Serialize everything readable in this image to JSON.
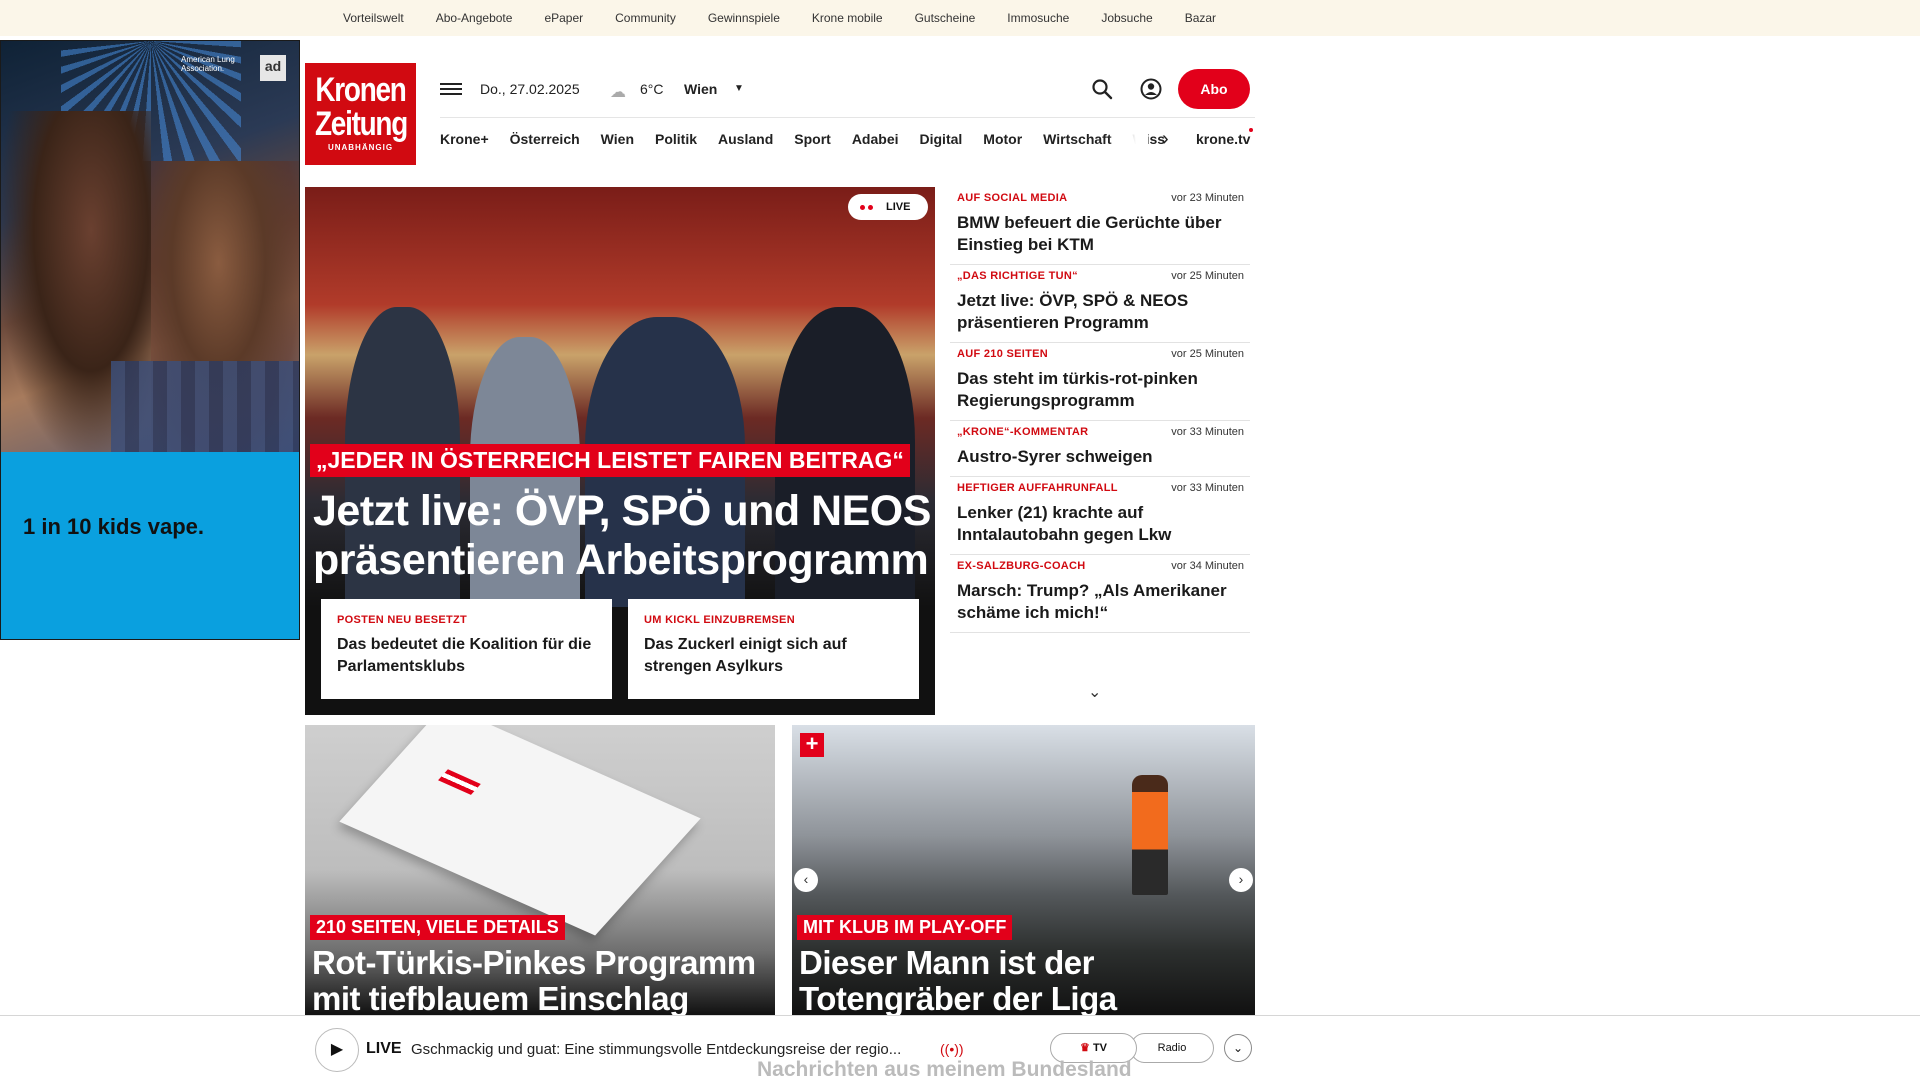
{
  "topbar": {
    "links": [
      "Vorteilswelt",
      "Abo-Angebote",
      "ePaper",
      "Community",
      "Gewinnspiele",
      "Krone mobile",
      "Gutscheine",
      "Immosuche",
      "Jobsuche",
      "Bazar"
    ]
  },
  "ad": {
    "sponsor": "American Lung Association.",
    "badge": "ad",
    "tagline": "1 in 10 kids vape."
  },
  "logo": {
    "line1": "Kronen",
    "line2": "Zeitung",
    "sub": "UNABHÄNGIG"
  },
  "header": {
    "date": "Do., 27.02.2025",
    "weather_icon": "cloud-icon",
    "temperature": "6°C",
    "city": "Wien",
    "abo": "Abo"
  },
  "nav": {
    "items": [
      "Krone+",
      "Österreich",
      "Wien",
      "Politik",
      "Ausland",
      "Sport",
      "Adabei",
      "Digital",
      "Motor",
      "Wirtschaft",
      "Wiss"
    ],
    "tv": "krone.tv"
  },
  "hero": {
    "live": "LIVE",
    "kicker": "„JEDER IN ÖSTERREICH LEISTET FAIREN BEITRAG“",
    "title": "Jetzt live: ÖVP, SPÖ und NEOS präsentieren Arbeitsprogramm",
    "cards": [
      {
        "kicker": "POSTEN NEU BESETZT",
        "headline": "Das bedeutet die Koalition für die Parlamentsklubs"
      },
      {
        "kicker": "UM KICKL EINZUBREMSEN",
        "headline": "Das Zuckerl einigt sich auf strengen Asylkurs"
      }
    ]
  },
  "news": [
    {
      "kicker": "AUF SOCIAL MEDIA",
      "time": "vor 23 Minuten",
      "headline": "BMW befeuert die Gerüchte über Einstieg bei KTM"
    },
    {
      "kicker": "„DAS RICHTIGE TUN“",
      "time": "vor 25 Minuten",
      "headline": "Jetzt live: ÖVP, SPÖ & NEOS präsentieren Programm"
    },
    {
      "kicker": "AUF 210 SEITEN",
      "time": "vor 25 Minuten",
      "headline": "Das steht im türkis-rot-pinken Regierungsprogramm"
    },
    {
      "kicker": "„KRONE“-KOMMENTAR",
      "time": "vor 33 Minuten",
      "headline": "Austro-Syrer schweigen"
    },
    {
      "kicker": "HEFTIGER AUFFAHRUNFALL",
      "time": "vor 33 Minuten",
      "headline": "Lenker (21) krachte auf Inntalautobahn gegen Lkw"
    },
    {
      "kicker": "EX-SALZBURG-COACH",
      "time": "vor 34 Minuten",
      "headline": "Marsch: Trump? „Als Amerikaner schäme ich mich!“"
    }
  ],
  "teasers": [
    {
      "kicker": "210 SEITEN, VIELE DETAILS",
      "headline": "Rot-Türkis-Pinkes Programm mit tiefblauem Einschlag"
    },
    {
      "kicker": "MIT KLUB IM PLAY-OFF",
      "headline": "Dieser Mann ist der Totengräber der Liga"
    }
  ],
  "player": {
    "live": "LIVE",
    "description": "Gschmackig und guat: Eine stimmungsvolle Entdeckungsreise der regio...",
    "tv": "TV",
    "radio": "Radio",
    "below_heading": "Nachrichten aus meinem Bundesland"
  },
  "colors": {
    "brand_red": "#e2001a",
    "topbar_bg": "#fbf6e9",
    "ad_blue": "#0aa0df"
  }
}
